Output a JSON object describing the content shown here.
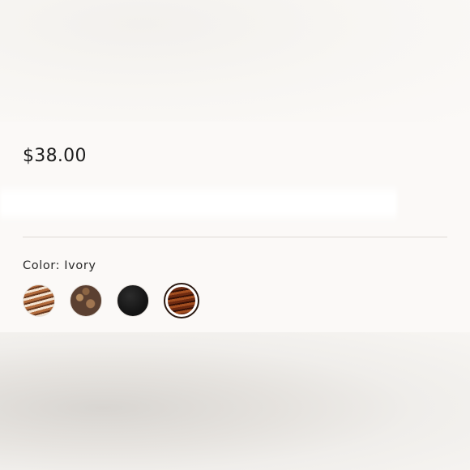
{
  "product": {
    "price": "$38.00"
  },
  "variant": {
    "color_label": "Color: Ivory",
    "swatches": [
      {
        "name": "swatch-1"
      },
      {
        "name": "swatch-2"
      },
      {
        "name": "swatch-3"
      },
      {
        "name": "swatch-4"
      }
    ],
    "selected_index": 3
  }
}
